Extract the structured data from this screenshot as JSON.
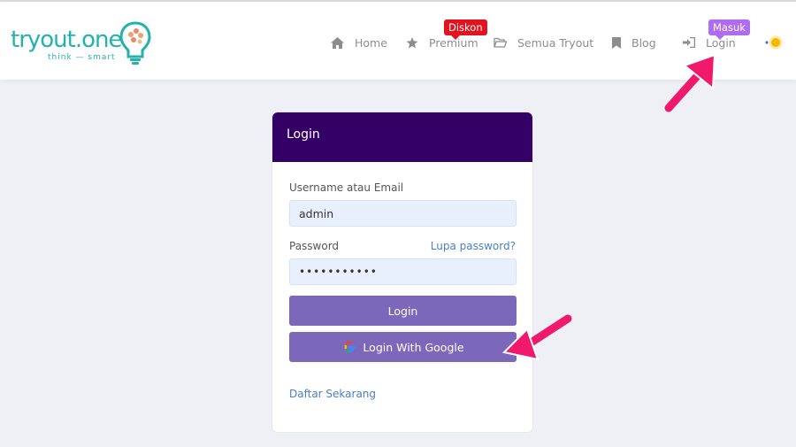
{
  "nav": {
    "logo_word": "tryout.one",
    "logo_tagline": "think — smart",
    "items": [
      {
        "label": "Home",
        "icon": "home-icon"
      },
      {
        "label": "Premium",
        "icon": "star-icon"
      },
      {
        "label": "Semua Tryout",
        "icon": "folder-icon"
      },
      {
        "label": "Blog",
        "icon": "bookmark-icon"
      },
      {
        "label": "Login",
        "icon": "sign-in-icon"
      }
    ],
    "badge_premium": "Diskon",
    "badge_login": "Masuk"
  },
  "login_card": {
    "title": "Login",
    "username_label": "Username atau Email",
    "username_value": "admin",
    "password_label": "Password",
    "password_value": "•••••••••••",
    "forgot_link": "Lupa password?",
    "login_button": "Login",
    "google_button": "Login With Google",
    "register_link": "Daftar Sekarang"
  },
  "colors": {
    "brand": "#23b2ae",
    "card_header": "#330066",
    "button": "#7b68bb",
    "badge_diskon": "#e3121f",
    "badge_masuk": "#b06cf0",
    "annotation_arrow": "#f0196b"
  }
}
